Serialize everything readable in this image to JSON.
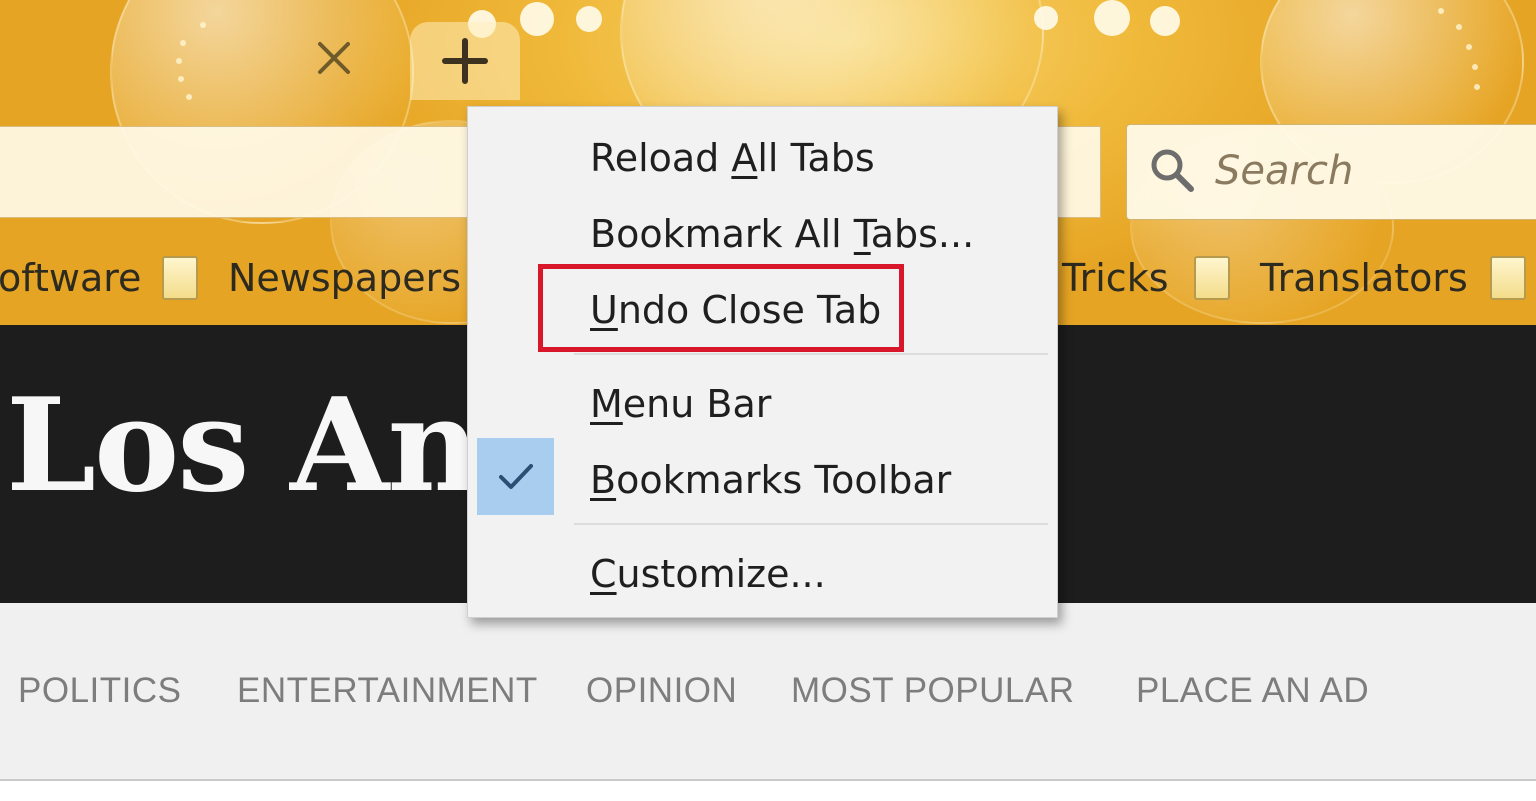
{
  "tabs": {
    "close_icon": "close-icon",
    "new_tab_icon": "plus-icon"
  },
  "search": {
    "placeholder": "Search",
    "icon": "search-icon"
  },
  "bookmarks_toolbar": {
    "items": [
      {
        "label": "oftware"
      },
      {
        "label": "Newspapers"
      },
      {
        "label": "Tricks"
      },
      {
        "label": "Translators"
      }
    ]
  },
  "page": {
    "logo_text": "Los Ange",
    "sections": [
      "POLITICS",
      "ENTERTAINMENT",
      "OPINION",
      "MOST POPULAR",
      "PLACE AN AD"
    ]
  },
  "context_menu": {
    "items": [
      {
        "pre": "Reload ",
        "key": "A",
        "post": "ll Tabs"
      },
      {
        "pre": "Bookmark All ",
        "key": "T",
        "post": "abs..."
      },
      {
        "pre": "",
        "key": "U",
        "post": "ndo Close Tab",
        "highlighted": true
      },
      {
        "pre": "",
        "key": "M",
        "post": "enu Bar"
      },
      {
        "pre": "",
        "key": "B",
        "post": "ookmarks Toolbar",
        "checked": true
      },
      {
        "pre": "",
        "key": "C",
        "post": "ustomize..."
      }
    ]
  },
  "colors": {
    "theme_gold": "#f0b93a",
    "highlight_border": "#d8182a",
    "check_bg": "#a9cdee",
    "masthead_bg": "#1d1d1d"
  }
}
